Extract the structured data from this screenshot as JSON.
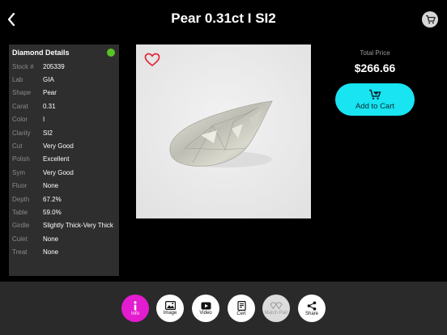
{
  "header": {
    "title": "Pear 0.31ct I SI2"
  },
  "details": {
    "title": "Diamond Details",
    "rows": [
      {
        "label": "Stock #",
        "value": "205339"
      },
      {
        "label": "Lab",
        "value": "GIA"
      },
      {
        "label": "Shape",
        "value": "Pear"
      },
      {
        "label": "Carat",
        "value": "0.31"
      },
      {
        "label": "Color",
        "value": "I"
      },
      {
        "label": "Clarity",
        "value": "SI2"
      },
      {
        "label": "Cut",
        "value": "Very Good"
      },
      {
        "label": "Polish",
        "value": "Excellent"
      },
      {
        "label": "Sym",
        "value": "Very Good"
      },
      {
        "label": "Fluor",
        "value": "None"
      },
      {
        "label": "Depth",
        "value": "67.2%"
      },
      {
        "label": "Table",
        "value": "59.0%"
      },
      {
        "label": "Girdle",
        "value": "Slightly Thick-Very Thick"
      },
      {
        "label": "Culet",
        "value": "None"
      },
      {
        "label": "Treat",
        "value": "None"
      }
    ],
    "status_color": "#59c226"
  },
  "price": {
    "label": "Total Price",
    "value": "$266.66"
  },
  "add_to_cart": {
    "label": "Add to Cart",
    "color": "#18e4f2"
  },
  "tabs": [
    {
      "label": "Info",
      "icon": "info-icon"
    },
    {
      "label": "Image",
      "icon": "image-icon"
    },
    {
      "label": "Video",
      "icon": "video-icon"
    },
    {
      "label": "Cert",
      "icon": "certificate-icon"
    },
    {
      "label": "Match Pair",
      "icon": "match-pair-icon"
    },
    {
      "label": "Share",
      "icon": "share-icon"
    }
  ],
  "accent_color": "#e31ccf"
}
